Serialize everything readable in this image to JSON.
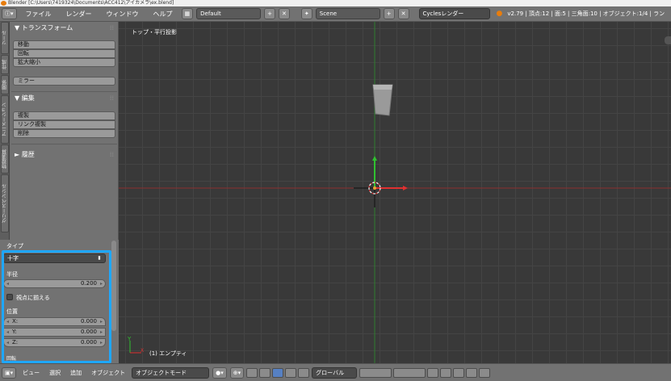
{
  "titlebar": {
    "text": "Blender [C:\\Users\\7419324\\Documents\\ACC412\\アイカメラ\\ex.blend]"
  },
  "menubar": {
    "info_icon": "info-icon",
    "menus": [
      "ファイル",
      "レンダー",
      "ウィンドウ",
      "ヘルプ"
    ],
    "layout": "Default",
    "scene": "Scene",
    "engine": "Cyclesレンダー",
    "stats": "v2.79 | 頂点:12 | 面:5 | 三角面:10 | オブジェクト:1/4 | ラン"
  },
  "tabs": [
    "ツール",
    "作成",
    "関係",
    "アニメーション",
    "物理演算",
    "グリースペンシル"
  ],
  "shelf": {
    "transform": {
      "title": "トランスフォーム",
      "buttons": [
        "移動",
        "回転",
        "拡大縮小"
      ],
      "mirror": "ミラー"
    },
    "edit": {
      "title": "編集",
      "buttons": [
        "複製",
        "リンク複製",
        "削除"
      ]
    },
    "history": {
      "title": "履歴"
    }
  },
  "operator": {
    "type_label": "タイプ",
    "type_value": "十字",
    "radius_label": "半径",
    "radius_value": "0.200",
    "align_label": "視点に揃える",
    "location_label": "位置",
    "x_label": "X:",
    "x_value": "0.000",
    "y_label": "Y:",
    "y_value": "0.000",
    "z_label": "Z:",
    "z_value": "0.000",
    "rotation_label": "回転"
  },
  "viewport": {
    "title": "トップ・平行投影",
    "object_label": "(1) エンプティ",
    "axis_label_y": "Y",
    "axis_label_x": "X",
    "colors": {
      "x_axis": "#c03a3a",
      "y_axis": "#3bab3b",
      "grid": "#444444"
    }
  },
  "footer": {
    "menus": [
      "ビュー",
      "選択",
      "追加",
      "オブジェクト"
    ],
    "mode": "オブジェクトモード",
    "orientation": "グローバル"
  }
}
